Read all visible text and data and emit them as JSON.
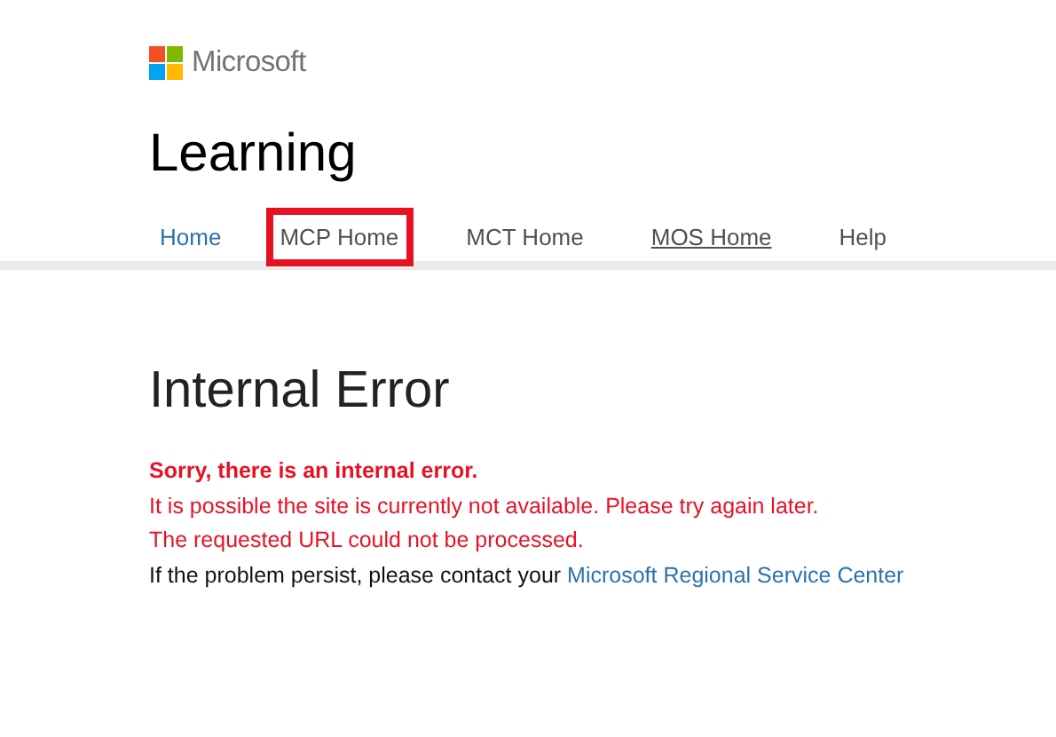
{
  "brand": {
    "name": "Microsoft"
  },
  "site_title": "Learning",
  "nav": [
    {
      "label": "Home",
      "color": "#2a72ab",
      "underlined": false,
      "highlighted": false
    },
    {
      "label": "MCP Home",
      "color": "#505050",
      "underlined": false,
      "highlighted": true
    },
    {
      "label": "MCT Home",
      "color": "#505050",
      "underlined": false,
      "highlighted": false
    },
    {
      "label": "MOS Home",
      "color": "#505050",
      "underlined": true,
      "highlighted": false
    },
    {
      "label": "Help",
      "color": "#505050",
      "underlined": false,
      "highlighted": false
    }
  ],
  "error": {
    "title": "Internal Error",
    "lines": [
      {
        "kind": "heading",
        "text": "Sorry, there is an internal error."
      },
      {
        "kind": "error",
        "text": "It is possible the site is currently not available. Please try again later."
      },
      {
        "kind": "error",
        "text": "The requested URL could not be processed."
      },
      {
        "kind": "info",
        "text": "If the problem persist, please contact your",
        "link": "Microsoft Regional Service Center"
      }
    ]
  }
}
